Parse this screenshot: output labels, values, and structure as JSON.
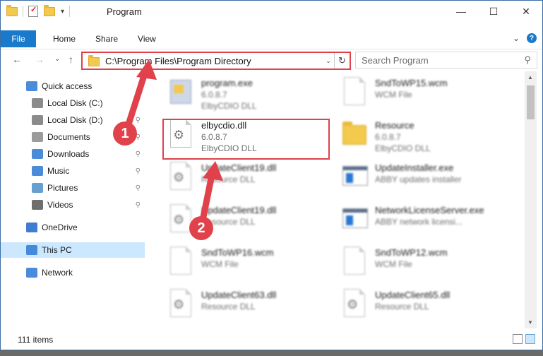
{
  "window": {
    "title": "Program",
    "controls": {
      "minimize": "—",
      "maximize": "☐",
      "close": "✕"
    }
  },
  "ribbon": {
    "tabs": [
      "File",
      "Home",
      "Share",
      "View"
    ],
    "expand_glyph": "⌄",
    "help_glyph": "?"
  },
  "navigation": {
    "back": "←",
    "forward": "→",
    "recent": "⌄",
    "up": "↑",
    "address": "C:\\Program Files\\Program Directory",
    "address_dropdown": "⌄",
    "refresh": "↻",
    "search_placeholder": "Search Program",
    "search_icon": "⚲"
  },
  "sidebar": {
    "items": [
      {
        "label": "Quick access",
        "icon": "star-icon",
        "pinned": false
      },
      {
        "label": "Local Disk (C:)",
        "icon": "drive-icon",
        "pinned": false
      },
      {
        "label": "Local Disk (D:)",
        "icon": "drive-icon",
        "pinned": true
      },
      {
        "label": "Documents",
        "icon": "documents-icon",
        "pinned": true
      },
      {
        "label": "Downloads",
        "icon": "downloads-icon",
        "pinned": true
      },
      {
        "label": "Music",
        "icon": "music-icon",
        "pinned": true
      },
      {
        "label": "Pictures",
        "icon": "pictures-icon",
        "pinned": true
      },
      {
        "label": "Videos",
        "icon": "videos-icon",
        "pinned": true
      },
      {
        "label": "OneDrive",
        "icon": "onedrive-icon",
        "pinned": false
      },
      {
        "label": "This PC",
        "icon": "pc-icon",
        "pinned": false,
        "selected": true
      },
      {
        "label": "Network",
        "icon": "network-icon",
        "pinned": false
      }
    ],
    "pin_glyph": "📌"
  },
  "files": [
    {
      "name": "program.exe",
      "line2": "6.0.8.7",
      "line3": "ElbyCDIO DLL",
      "type": "exe",
      "blurred": true
    },
    {
      "name": "SndToWP15.wcm",
      "line2": "WCM File",
      "line3": "",
      "type": "blank",
      "blurred": true
    },
    {
      "name": "elbycdio.dll",
      "line2": "6.0.8.7",
      "line3": "ElbyCDIO DLL",
      "type": "dll",
      "blurred": false
    },
    {
      "name": "Resource",
      "line2": "6.0.8.7",
      "line3": "ElbyCDIO DLL",
      "type": "folder",
      "blurred": true
    },
    {
      "name": "UpdateClient19.dll",
      "line2": "Resource DLL",
      "line3": "",
      "type": "dll",
      "blurred": true
    },
    {
      "name": "UpdateInstaller.exe",
      "line2": "ABBY updates installer",
      "line3": "",
      "type": "win",
      "blurred": true
    },
    {
      "name": "UpdateClient19.dll",
      "line2": "Resource DLL",
      "line3": "",
      "type": "dll",
      "blurred": true
    },
    {
      "name": "NetworkLicenseServer.exe",
      "line2": "ABBY network licensi...",
      "line3": "",
      "type": "win",
      "blurred": true
    },
    {
      "name": "SndToWP16.wcm",
      "line2": "WCM File",
      "line3": "",
      "type": "blank",
      "blurred": true
    },
    {
      "name": "SndToWP12.wcm",
      "line2": "WCM File",
      "line3": "",
      "type": "blank",
      "blurred": true
    },
    {
      "name": "UpdateClient63.dll",
      "line2": "Resource DLL",
      "line3": "",
      "type": "dll",
      "blurred": true
    },
    {
      "name": "UpdateClient65.dll",
      "line2": "Resource DLL",
      "line3": "",
      "type": "dll",
      "blurred": true
    }
  ],
  "status": {
    "item_count": "111 items"
  },
  "annotations": {
    "badge1": "1",
    "badge2": "2"
  },
  "colors": {
    "accent": "#1979ca",
    "highlight": "#e0414a",
    "selection": "#cce8ff"
  }
}
